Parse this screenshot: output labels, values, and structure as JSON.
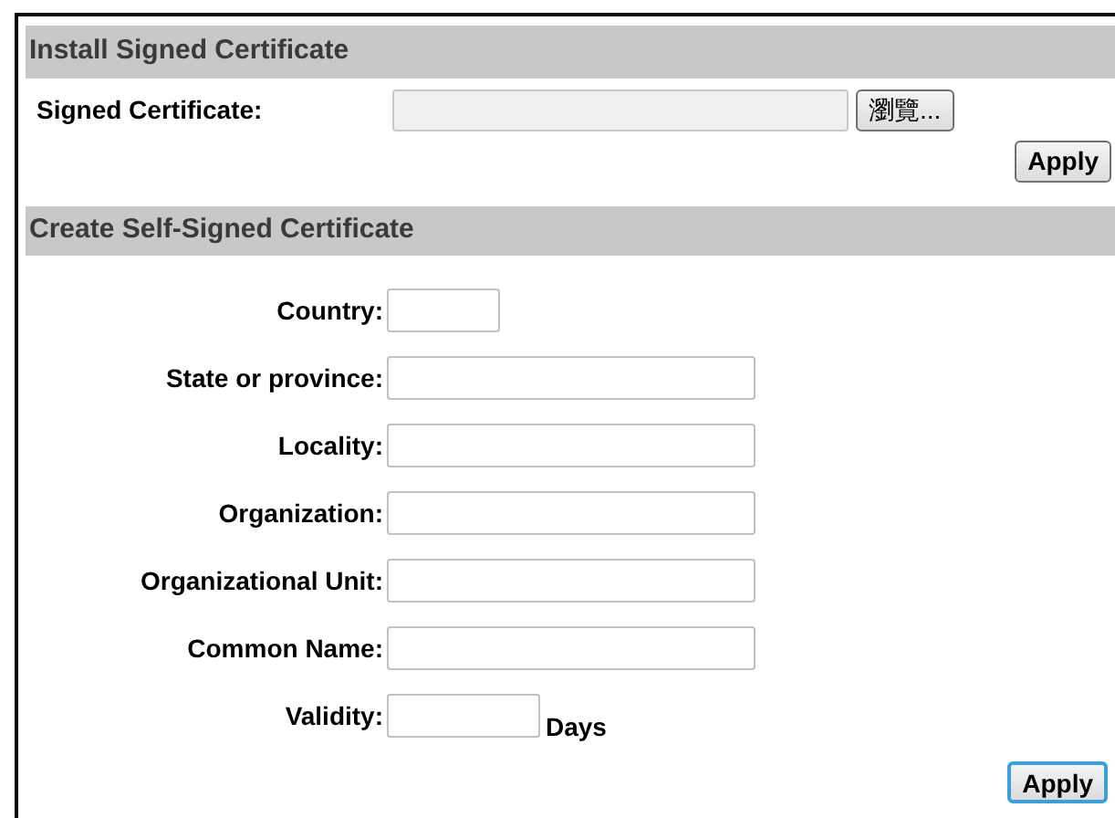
{
  "install": {
    "title": "Install Signed Certificate",
    "label": "Signed Certificate:",
    "browse_button": "瀏覽...",
    "apply_button": {
      "label": "Apply",
      "focused": false
    }
  },
  "create": {
    "title": "Create Self-Signed Certificate",
    "fields": [
      {
        "label": "Country:",
        "kind": "code"
      },
      {
        "label": "State or province:",
        "kind": "text"
      },
      {
        "label": "Locality:",
        "kind": "text"
      },
      {
        "label": "Organization:",
        "kind": "text"
      },
      {
        "label": "Organizational Unit:",
        "kind": "text"
      },
      {
        "label": "Common Name:",
        "kind": "text"
      },
      {
        "label": "Validity:",
        "kind": "number",
        "suffix": "Days"
      }
    ],
    "apply_button": {
      "label": "Apply",
      "focused": true
    }
  }
}
